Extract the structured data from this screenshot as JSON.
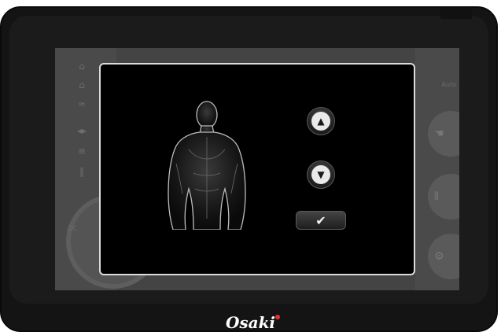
{
  "left_menu": {
    "icons": [
      "head-neck-icon",
      "shoulder-icon",
      "back-icon",
      "waist-icon",
      "seat-icon",
      "legs-icon"
    ],
    "dial_text": "OC"
  },
  "right_menu": {
    "top_text": "Auto",
    "icons": [
      "hand-icon",
      "adjust-icon",
      "settings-icon"
    ]
  },
  "modal": {
    "figure": "body-silhouette-icon",
    "up_glyph": "▲",
    "down_glyph": "▼",
    "confirm_glyph": "✔"
  },
  "brand": {
    "name": "Osaki",
    "dot_color": "#e53030"
  }
}
